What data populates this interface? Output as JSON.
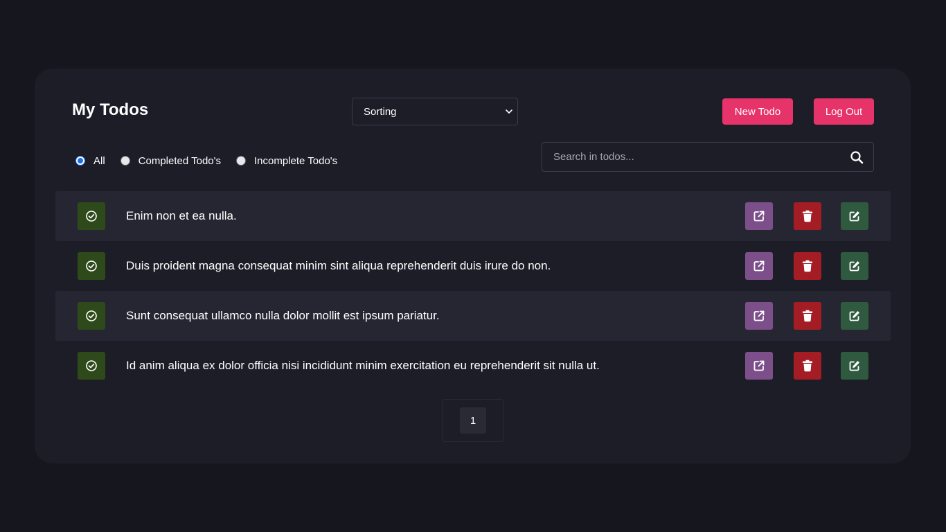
{
  "header": {
    "title": "My Todos",
    "sort_value": "Sorting",
    "new_todo_label": "New Todo",
    "logout_label": "Log Out"
  },
  "filters": {
    "options": [
      {
        "label": "All",
        "checked": true
      },
      {
        "label": "Completed Todo's",
        "checked": false
      },
      {
        "label": "Incomplete Todo's",
        "checked": false
      }
    ]
  },
  "search": {
    "placeholder": "Search in todos...",
    "value": ""
  },
  "todos": [
    {
      "text": "Enim non et ea nulla."
    },
    {
      "text": "Duis proident magna consequat minim sint aliqua reprehenderit duis irure do non."
    },
    {
      "text": "Sunt consequat ullamco nulla dolor mollit est ipsum pariatur."
    },
    {
      "text": "Id anim aliqua ex dolor officia nisi incididunt minim exercitation eu reprehenderit sit nulla ut."
    }
  ],
  "pagination": {
    "current_page": "1"
  },
  "icons": {
    "status": "check-circle-icon",
    "open": "external-link-icon",
    "delete": "trash-icon",
    "edit": "edit-icon",
    "search": "search-icon",
    "sort": "chevron-down-icon"
  },
  "colors": {
    "background": "#16161f",
    "card": "#1d1d28",
    "accent": "#e6336a",
    "status_button": "#2f4a1a",
    "open_button": "#7c4f8a",
    "delete_button": "#a51d24",
    "edit_button": "#2f5a40",
    "row_stripe": "#262633"
  }
}
